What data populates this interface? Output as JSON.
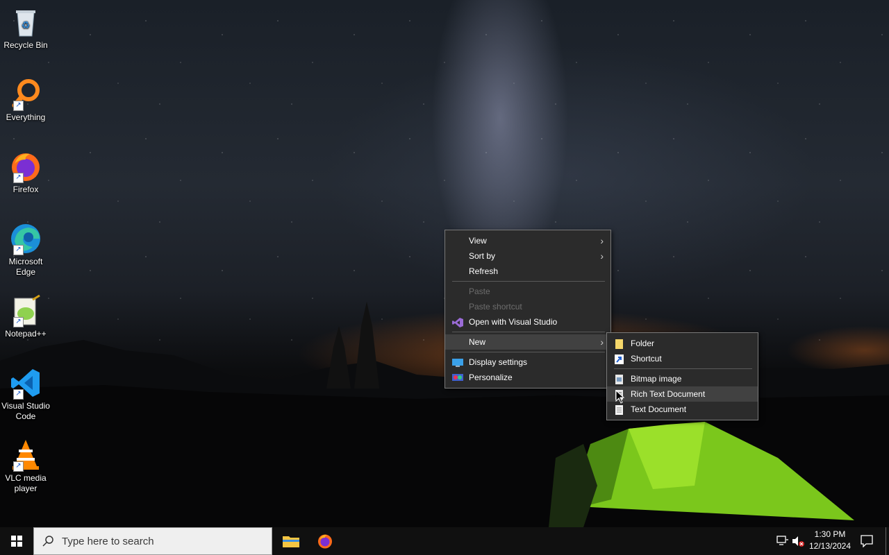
{
  "desktop_icons": [
    {
      "label": "Recycle Bin",
      "icon": "recycle-bin-icon"
    },
    {
      "label": "Everything",
      "icon": "everything-search-icon"
    },
    {
      "label": "Firefox",
      "icon": "firefox-icon"
    },
    {
      "label": "Microsoft Edge",
      "icon": "edge-icon"
    },
    {
      "label": "Notepad++",
      "icon": "notepadpp-icon"
    },
    {
      "label": "Visual Studio Code",
      "icon": "vscode-icon"
    },
    {
      "label": "VLC media player",
      "icon": "vlc-icon"
    }
  ],
  "context_menu": {
    "view": "View",
    "sort_by": "Sort by",
    "refresh": "Refresh",
    "paste": "Paste",
    "paste_shortcut": "Paste shortcut",
    "open_with_vs": "Open with Visual Studio",
    "new": "New",
    "display_settings": "Display settings",
    "personalize": "Personalize"
  },
  "new_submenu": {
    "folder": "Folder",
    "shortcut": "Shortcut",
    "bitmap": "Bitmap image",
    "rich_text": "Rich Text Document",
    "text_doc": "Text Document"
  },
  "taskbar": {
    "search_placeholder": "Type here to search",
    "time": "1:30 PM",
    "date": "12/13/2024",
    "apps": [
      "file-explorer-icon",
      "firefox-icon"
    ]
  },
  "colors": {
    "menu_bg": "#2b2b2b",
    "menu_hover": "#414141",
    "taskbar_bg": "#101010",
    "accent_green": "#7ecb1e"
  }
}
